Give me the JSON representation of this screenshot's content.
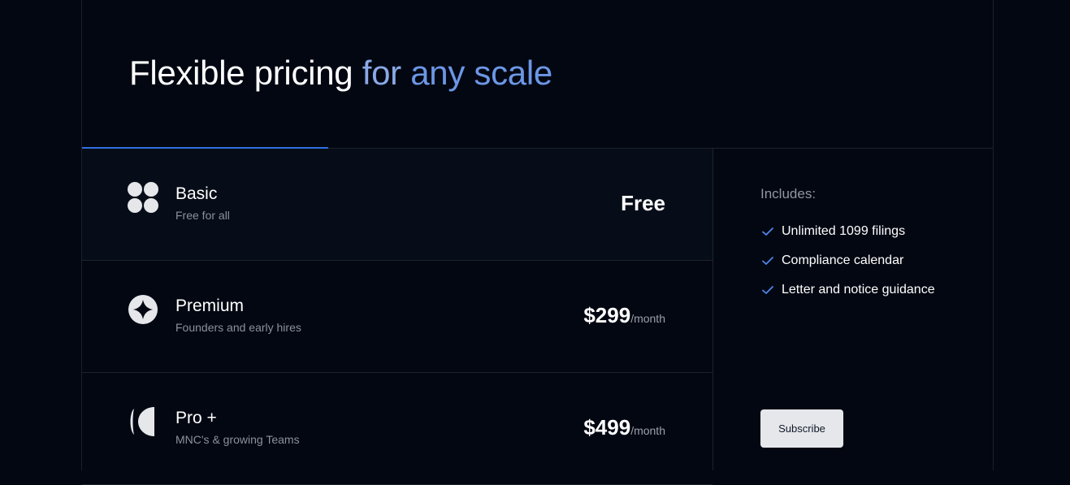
{
  "headline": {
    "part1": "Flexible pricing",
    "part2": "for",
    "part3": "any scale"
  },
  "colors": {
    "background": "#030712",
    "accent": "#2f6fe0",
    "headline_blue_light": "#8aa9e6",
    "headline_blue": "#6c97e6",
    "button_bg": "#e5e7eb"
  },
  "plans": [
    {
      "name": "Basic",
      "subtitle": "Free for all",
      "price": "Free",
      "period": "",
      "icon": "four-circles-icon",
      "active": true
    },
    {
      "name": "Premium",
      "subtitle": "Founders and early hires",
      "price": "$299",
      "period": "/month",
      "icon": "sparkle-star-icon",
      "active": false
    },
    {
      "name": "Pro +",
      "subtitle": "MNC's & growing Teams",
      "price": "$499",
      "period": "/month",
      "icon": "half-moon-icon",
      "active": false
    }
  ],
  "features": {
    "label": "Includes:",
    "items": [
      "Unlimited 1099 filings",
      "Compliance calendar",
      "Letter and notice guidance"
    ],
    "check_icon": "checkmark-icon"
  },
  "subscribe_label": "Subscribe"
}
